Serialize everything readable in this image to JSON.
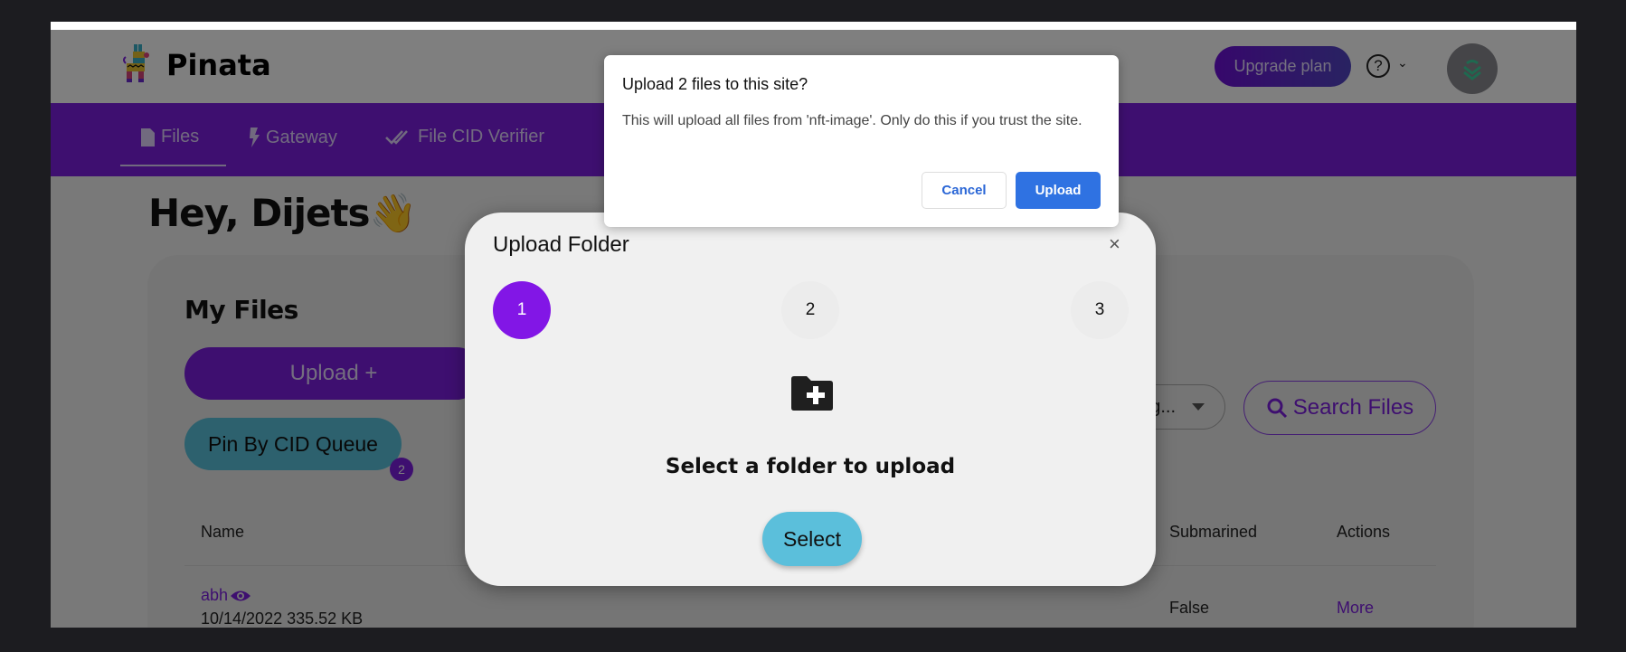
{
  "header": {
    "brand": "Pinata",
    "upgrade_label": "Upgrade plan",
    "help_glyph": "?",
    "help_chevron": "⌄"
  },
  "nav": {
    "items": [
      {
        "label": "Files",
        "icon": "file-icon",
        "active": true
      },
      {
        "label": "Gateway",
        "icon": "bolt-icon",
        "active": false
      },
      {
        "label": "File CID Verifier",
        "icon": "double-check-icon",
        "active": false
      }
    ]
  },
  "greeting": "Hey, Dijets👋",
  "files_card": {
    "title": "My Files",
    "upload_label": "Upload +",
    "pin_queue_label": "Pin By CID Queue",
    "pin_queue_count": "2",
    "filter_value": "rg...",
    "search_label": "Search Files",
    "columns": [
      "Name",
      "Submarined",
      "Actions"
    ],
    "rows": [
      {
        "name": "abh",
        "date_size": "10/14/2022 335.52 KB",
        "submarined": "False",
        "action": "More"
      }
    ]
  },
  "upload_modal": {
    "title": "Upload Folder",
    "close_glyph": "×",
    "steps": [
      {
        "label": "1",
        "active": true
      },
      {
        "label": "2",
        "active": false
      },
      {
        "label": "3",
        "active": false
      }
    ],
    "prompt": "Select a folder to upload",
    "select_label": "Select"
  },
  "confirm_dialog": {
    "title": "Upload 2 files to this site?",
    "body": "This will upload all files from 'nft-image'. Only do this if you trust the site.",
    "cancel_label": "Cancel",
    "upload_label": "Upload"
  },
  "colors": {
    "brand_purple": "#7c1ee0",
    "step_active": "#8216e6",
    "teal": "#5bc3dc",
    "dialog_blue": "#2f72e2"
  }
}
